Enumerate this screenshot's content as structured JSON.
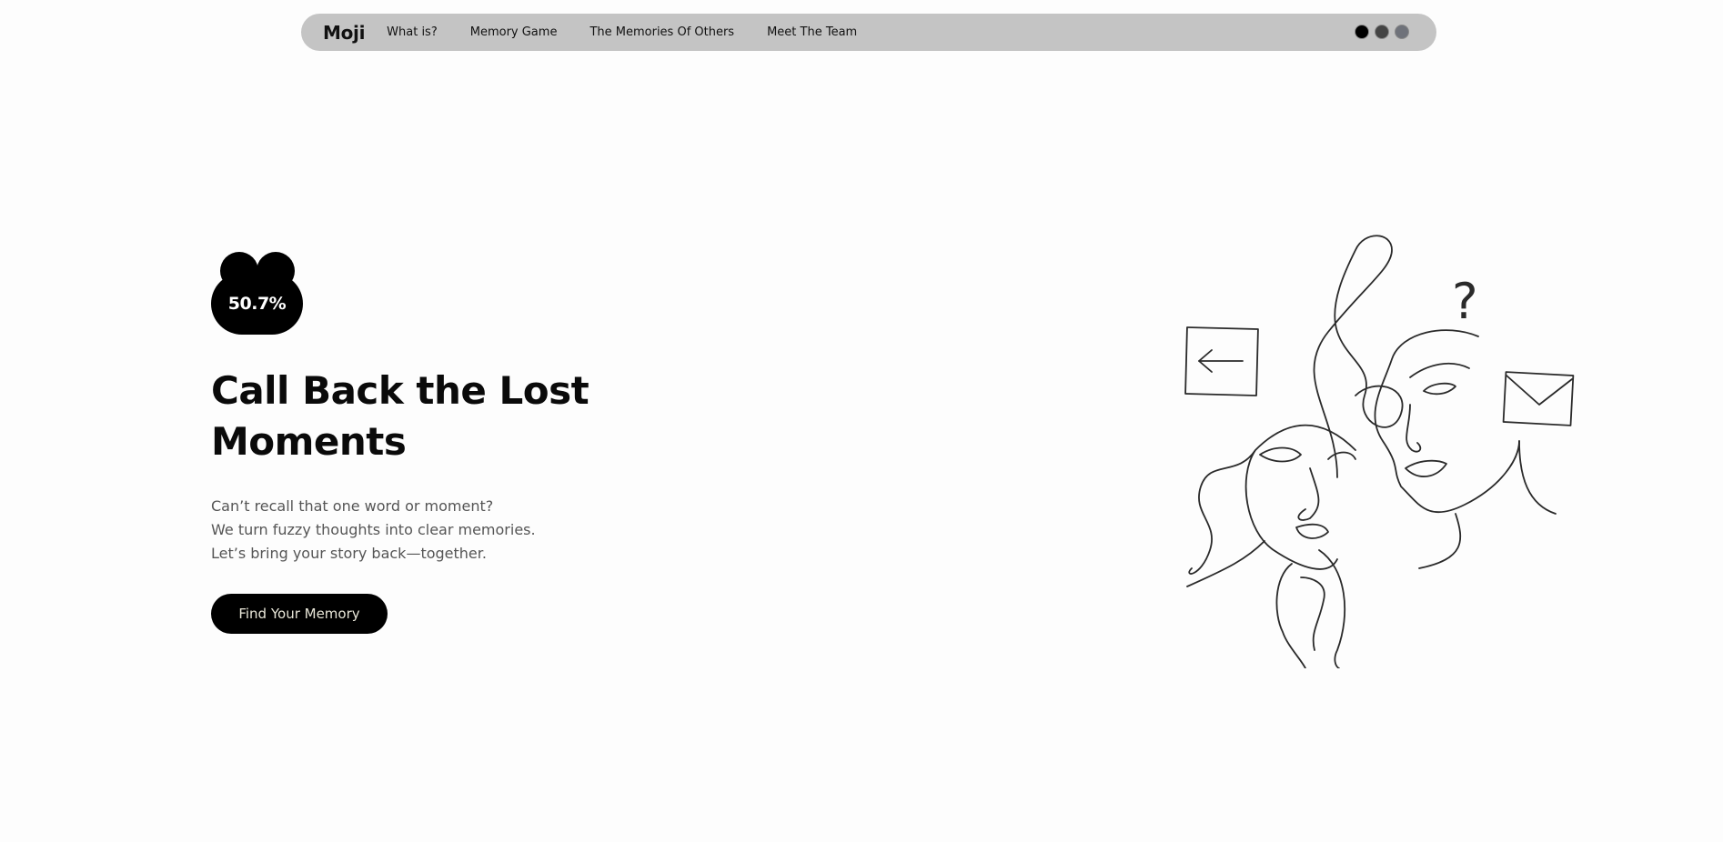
{
  "nav": {
    "brand": "Moji",
    "links": [
      {
        "label": "What is?"
      },
      {
        "label": "Memory Game"
      },
      {
        "label": "The Memories Of Others"
      },
      {
        "label": "Meet The Team"
      }
    ],
    "theme_dots": [
      {
        "name": "black",
        "color": "#000000"
      },
      {
        "name": "dark-gray",
        "color": "#444444"
      },
      {
        "name": "slate-gray",
        "color": "#6f727a"
      }
    ],
    "bar_color": "#c4c4c4"
  },
  "hero": {
    "badge_value": "50.7%",
    "title": "Call Back the Lost Moments",
    "subtitle_lines": [
      "Can’t recall that one word or moment?",
      "We turn fuzzy thoughts into clear memories.",
      "Let’s bring your story back—together."
    ],
    "cta_label": "Find Your Memory"
  },
  "illustration": {
    "question_mark": "?",
    "icons": [
      "back-arrow-icon",
      "envelope-icon"
    ]
  }
}
